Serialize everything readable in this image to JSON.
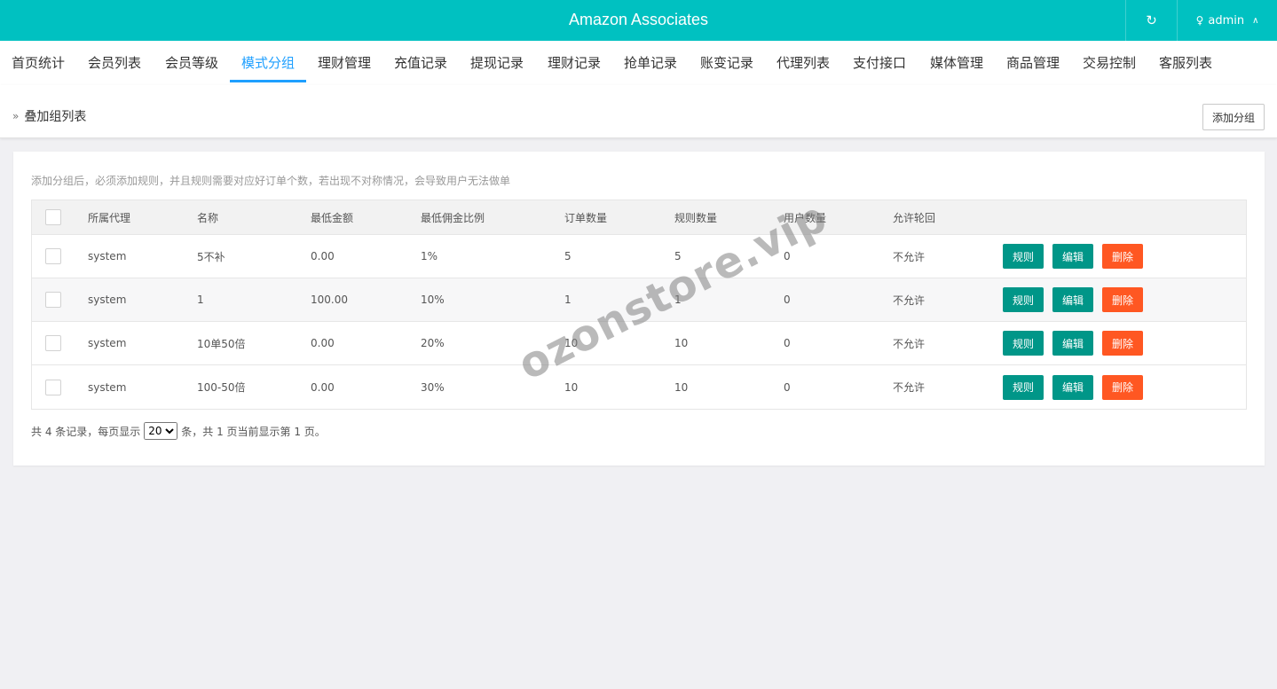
{
  "header": {
    "title": "Amazon Associates",
    "refresh_icon": "refresh-icon",
    "user_icon": "user-icon",
    "user_name": "admin",
    "chevron_icon": "chevron-up-icon"
  },
  "nav": {
    "items": [
      "首页统计",
      "会员列表",
      "会员等级",
      "模式分组",
      "理财管理",
      "充值记录",
      "提现记录",
      "理财记录",
      "抢单记录",
      "账变记录",
      "代理列表",
      "支付接口",
      "媒体管理",
      "商品管理",
      "交易控制",
      "客服列表"
    ],
    "active": "模式分组"
  },
  "subheader": {
    "breadcrumb": "叠加组列表",
    "add_button": "添加分组"
  },
  "notice": "添加分组后，必须添加规则，并且规则需要对应好订单个数，若出现不对称情况，会导致用户无法做单",
  "table": {
    "columns": [
      "所属代理",
      "名称",
      "最低金额",
      "最低佣金比例",
      "订单数量",
      "规则数量",
      "用户数量",
      "允许轮回"
    ],
    "rows": [
      [
        "system",
        "5不补",
        "0.00",
        "1%",
        "5",
        "5",
        "0",
        "不允许"
      ],
      [
        "system",
        "1",
        "100.00",
        "10%",
        "1",
        "1",
        "0",
        "不允许"
      ],
      [
        "system",
        "10单50倍",
        "0.00",
        "20%",
        "10",
        "10",
        "0",
        "不允许"
      ],
      [
        "system",
        "100-50倍",
        "0.00",
        "30%",
        "10",
        "10",
        "0",
        "不允许"
      ]
    ],
    "actions": [
      "规则",
      "编辑",
      "删除"
    ]
  },
  "pager": {
    "prefix": "共 4 条记录，每页显示",
    "page_size": "20",
    "suffix": "条，共 1 页当前显示第 1 页。"
  },
  "watermark": "ozonstore.vip",
  "colors": {
    "header_bg": "#00c1c1",
    "accent": "#1e9fff",
    "action_green": "#009688",
    "action_red": "#ff5722"
  }
}
